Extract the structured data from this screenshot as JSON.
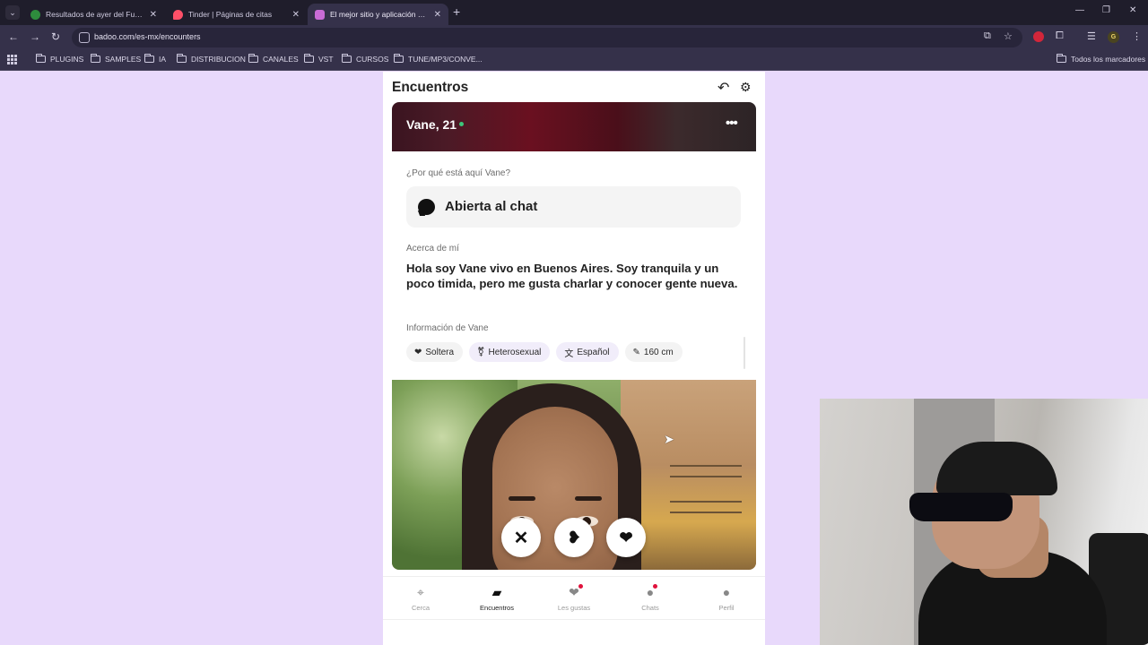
{
  "browser": {
    "tabs": [
      {
        "title": "Resultados de ayer del Futbol á",
        "favicon_color": "#2e8b3d"
      },
      {
        "title": "Tinder | Páginas de citas",
        "favicon_color": "#fd5068"
      },
      {
        "title": "El mejor sitio y aplicación de ci",
        "favicon_color": "#c96bd6"
      }
    ],
    "url": "badoo.com/es-mx/encounters",
    "bookmarks": [
      "PLUGINS",
      "SAMPLES",
      "IA",
      "DISTRIBUCION",
      "CANALES",
      "VST",
      "CURSOS",
      "TUNE/MP3/CONVE..."
    ],
    "all_bookmarks_label": "Todos los marcadores",
    "profile_initial": "G"
  },
  "page": {
    "title": "Encuentros",
    "profile": {
      "name_age": "Vane, 21",
      "why_here_label": "¿Por qué está aquí Vane?",
      "why_here_value": "Abierta al chat",
      "about_label": "Acerca de mí",
      "about_text": "Hola soy Vane vivo en Buenos Aires. Soy tranquila y un poco timida, pero me gusta charlar y conocer gente nueva.",
      "info_label": "Información de Vane",
      "chips": [
        {
          "icon": "heart-icon",
          "label": "Soltera"
        },
        {
          "icon": "gender-icon",
          "label": "Heterosexual"
        },
        {
          "icon": "translate-icon",
          "label": "Español"
        },
        {
          "icon": "ruler-icon",
          "label": "160 cm"
        }
      ]
    },
    "nav": [
      {
        "icon": "location-pin-icon",
        "label": "Cerca",
        "active": false,
        "badge": false
      },
      {
        "icon": "cards-icon",
        "label": "Encuentros",
        "active": true,
        "badge": false
      },
      {
        "icon": "heart-icon",
        "label": "Les gustas",
        "active": false,
        "badge": true
      },
      {
        "icon": "chat-bubble-icon",
        "label": "Chats",
        "active": false,
        "badge": true
      },
      {
        "icon": "person-icon",
        "label": "Perfil",
        "active": false,
        "badge": false
      }
    ],
    "colors": {
      "background": "#e8d9fb",
      "badge": "#e0123c",
      "chip": "#f1edfa"
    }
  }
}
